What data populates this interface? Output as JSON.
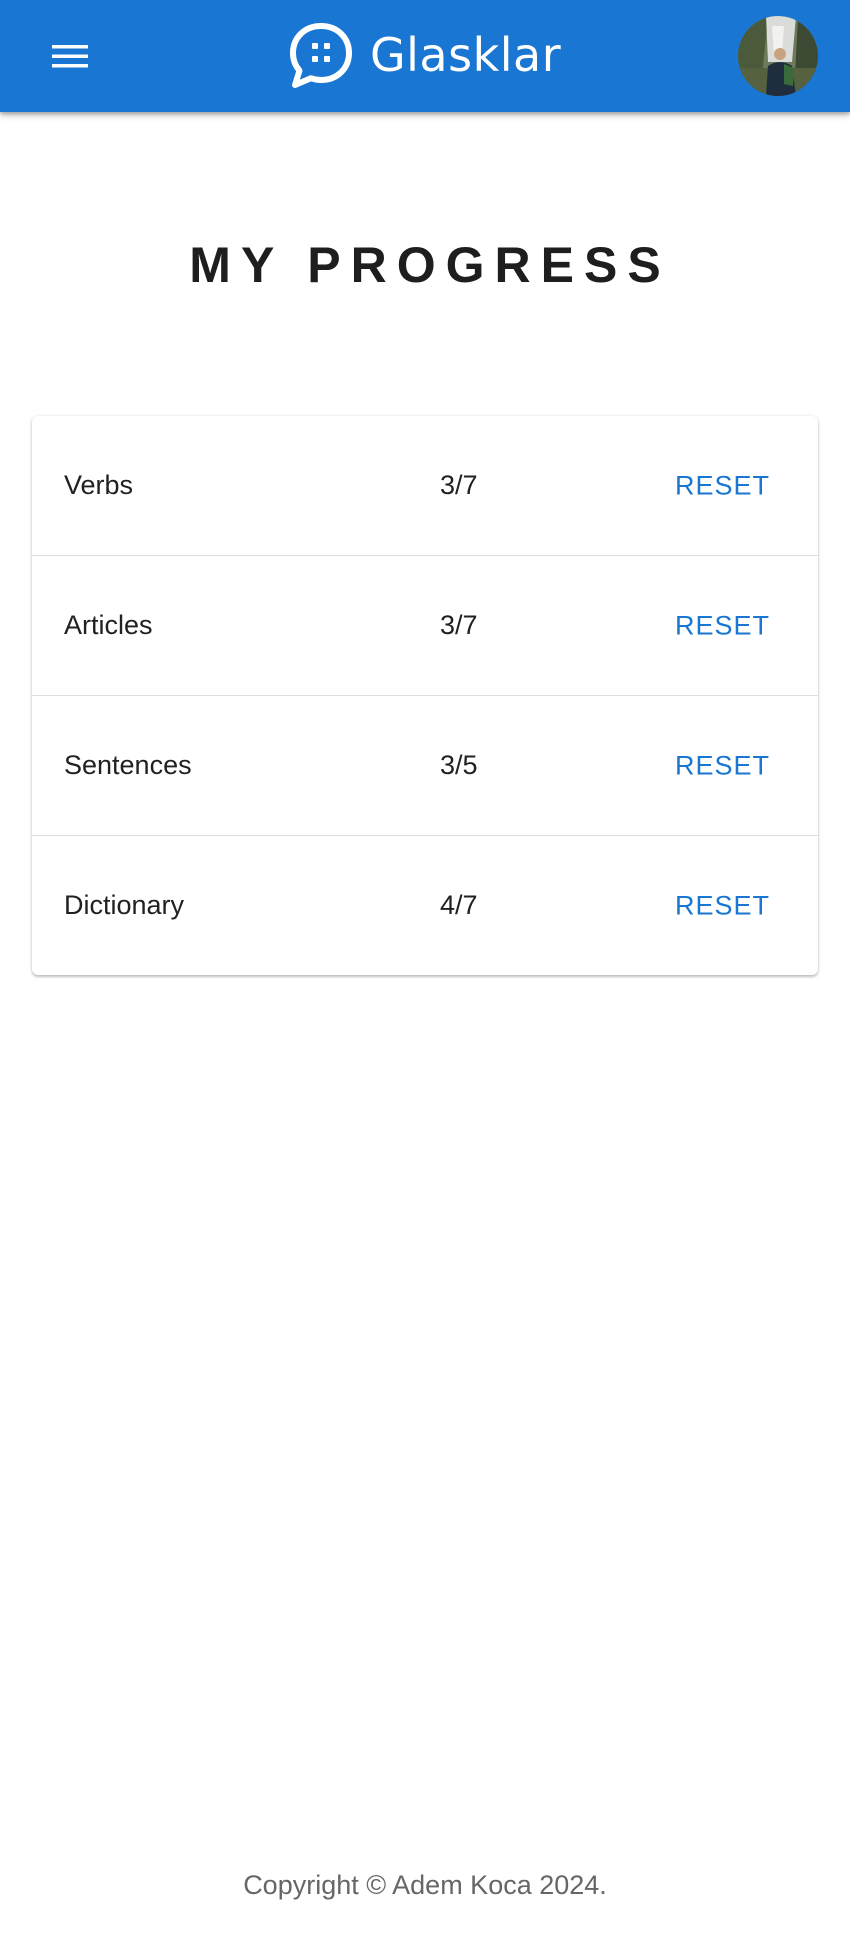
{
  "app": {
    "name": "Glasklar",
    "menu_icon": "menu-icon",
    "logo_icon": "chat-bubble-icon",
    "avatar": "user-avatar"
  },
  "colors": {
    "primary": "#1976d2",
    "text": "#212121",
    "muted": "#666666",
    "background": "#ffffff"
  },
  "page": {
    "title": "MY PROGRESS"
  },
  "progress": {
    "items": [
      {
        "label": "Verbs",
        "count": "3/7",
        "reset": "RESET"
      },
      {
        "label": "Articles",
        "count": "3/7",
        "reset": "RESET"
      },
      {
        "label": "Sentences",
        "count": "3/5",
        "reset": "RESET"
      },
      {
        "label": "Dictionary",
        "count": "4/7",
        "reset": "RESET"
      }
    ]
  },
  "footer": {
    "copyright": "Copyright © Adem Koca 2024."
  }
}
